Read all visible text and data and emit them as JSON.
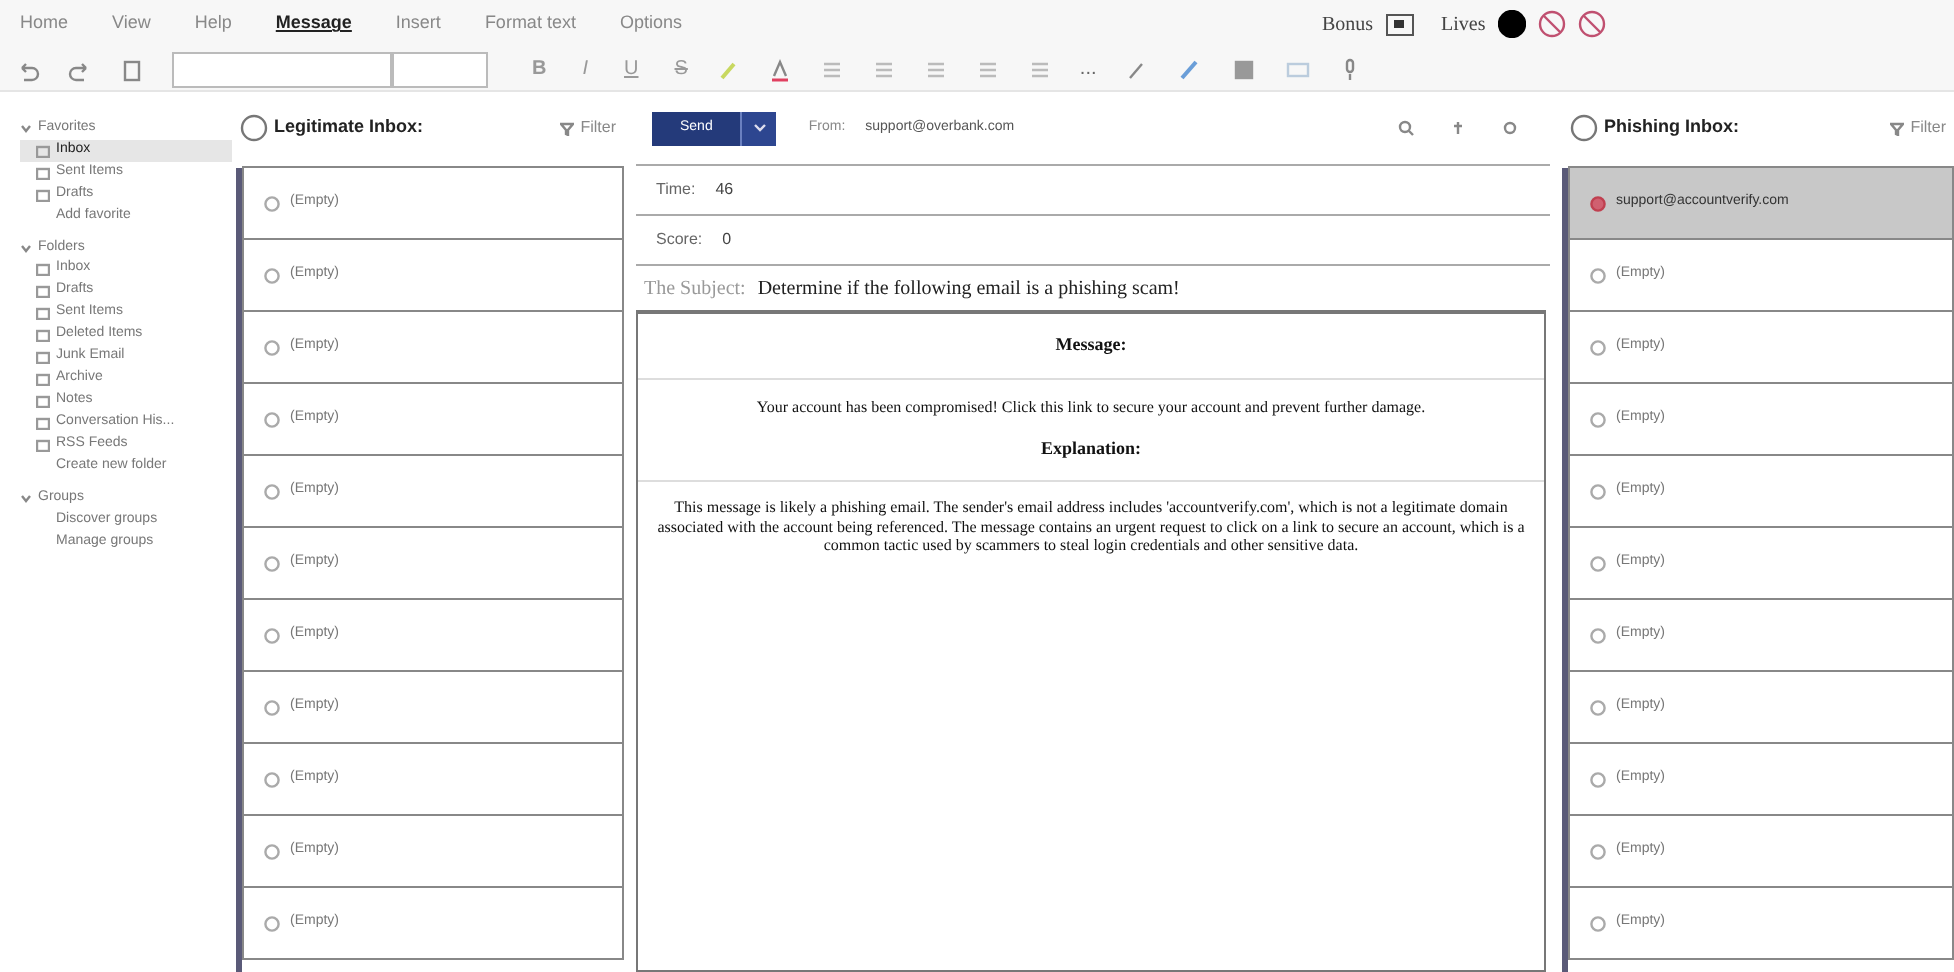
{
  "menu": [
    {
      "label": "Home",
      "selected": false
    },
    {
      "label": "View",
      "selected": false
    },
    {
      "label": "Help",
      "selected": false
    },
    {
      "label": "Message",
      "selected": true
    },
    {
      "label": "Insert",
      "selected": false
    },
    {
      "label": "Format text",
      "selected": false
    },
    {
      "label": "Options",
      "selected": false
    }
  ],
  "status": {
    "bonus_label": "Bonus",
    "bonus_checked": true,
    "lives_label": "Lives",
    "lives": [
      {
        "lost": false
      },
      {
        "lost": true
      },
      {
        "lost": true
      }
    ]
  },
  "toolbar": {
    "format_glyphs": [
      "B",
      "I",
      "U",
      "S"
    ],
    "more": "..."
  },
  "sidebar": [
    {
      "label": "Favorites",
      "expanded": true,
      "items": [
        {
          "label": "Inbox",
          "selected": true
        },
        {
          "label": "Sent Items",
          "selected": false
        },
        {
          "label": "Drafts",
          "selected": false
        },
        {
          "label": "Add favorite",
          "selected": false,
          "kind": "link"
        }
      ]
    },
    {
      "label": "Folders",
      "expanded": true,
      "items": [
        {
          "label": "Inbox",
          "selected": false
        },
        {
          "label": "Drafts",
          "selected": false
        },
        {
          "label": "Sent Items",
          "selected": false
        },
        {
          "label": "Deleted Items",
          "selected": false
        },
        {
          "label": "Junk Email",
          "selected": false
        },
        {
          "label": "Archive",
          "selected": false
        },
        {
          "label": "Notes",
          "selected": false
        },
        {
          "label": "Conversation His...",
          "selected": false
        },
        {
          "label": "RSS Feeds",
          "selected": false
        },
        {
          "label": "Create new folder",
          "selected": false,
          "kind": "link"
        }
      ]
    },
    {
      "label": "Groups",
      "expanded": true,
      "items": [
        {
          "label": "Discover groups",
          "selected": false,
          "kind": "link"
        },
        {
          "label": "Manage groups",
          "selected": false,
          "kind": "link"
        }
      ]
    }
  ],
  "legit_inbox": {
    "title": "Legitimate Inbox:",
    "filter": "Filter",
    "rows": [
      {
        "label": "(Empty)",
        "selected": false
      },
      {
        "label": "(Empty)",
        "selected": false
      },
      {
        "label": "(Empty)",
        "selected": false
      },
      {
        "label": "(Empty)",
        "selected": false
      },
      {
        "label": "(Empty)",
        "selected": false
      },
      {
        "label": "(Empty)",
        "selected": false
      },
      {
        "label": "(Empty)",
        "selected": false
      },
      {
        "label": "(Empty)",
        "selected": false
      },
      {
        "label": "(Empty)",
        "selected": false
      },
      {
        "label": "(Empty)",
        "selected": false
      },
      {
        "label": "(Empty)",
        "selected": false
      }
    ]
  },
  "compose": {
    "send": "Send",
    "from_label": "From:",
    "from": "support@overbank.com",
    "time_label": "Time:",
    "time": "46",
    "score_label": "Score:",
    "score": "0",
    "subject_label": "The Subject:",
    "subject": "Determine if the following email is a phishing scam!",
    "message_heading": "Message:",
    "message": "Your account has been compromised! Click this link to secure your account and prevent further damage.",
    "explanation_heading": "Explanation:",
    "explanation": "This message is likely a phishing email. The sender's email address includes 'accountverify.com', which is not a legitimate domain associated with the account being referenced. The message contains an urgent request to click on a link to secure an account, which is a common tactic used by scammers to steal login credentials and other sensitive data."
  },
  "phishing_inbox": {
    "title": "Phishing Inbox:",
    "filter": "Filter",
    "rows": [
      {
        "label": "support@accountverify.com",
        "selected": true
      },
      {
        "label": "(Empty)",
        "selected": false
      },
      {
        "label": "(Empty)",
        "selected": false
      },
      {
        "label": "(Empty)",
        "selected": false
      },
      {
        "label": "(Empty)",
        "selected": false
      },
      {
        "label": "(Empty)",
        "selected": false
      },
      {
        "label": "(Empty)",
        "selected": false
      },
      {
        "label": "(Empty)",
        "selected": false
      },
      {
        "label": "(Empty)",
        "selected": false
      },
      {
        "label": "(Empty)",
        "selected": false
      },
      {
        "label": "(Empty)",
        "selected": false
      }
    ]
  }
}
